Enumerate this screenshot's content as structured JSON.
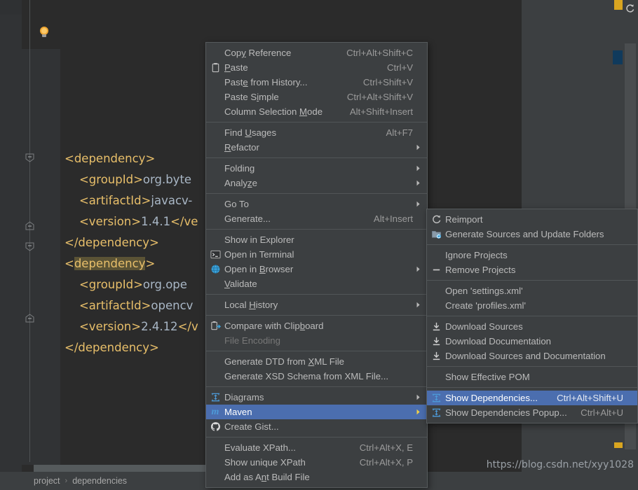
{
  "editor": {
    "breadcrumb": {
      "items": [
        "project",
        "dependencies"
      ],
      "separator": "›"
    },
    "watermark": "https://blog.csdn.net/xyy1028",
    "code_lines": [
      {
        "indent": 0,
        "segments": [
          {
            "t": "<dependency>",
            "c": "tag"
          }
        ]
      },
      {
        "indent": 1,
        "segments": [
          {
            "t": "<groupId>",
            "c": "tag"
          },
          {
            "t": "org.byte",
            "c": "txt"
          }
        ]
      },
      {
        "indent": 1,
        "segments": [
          {
            "t": "<artifactId>",
            "c": "tag"
          },
          {
            "t": "javacv-",
            "c": "txt"
          }
        ]
      },
      {
        "indent": 1,
        "segments": [
          {
            "t": "<version>",
            "c": "tag"
          },
          {
            "t": "1.4.1",
            "c": "txt"
          },
          {
            "t": "</ve",
            "c": "tag"
          }
        ]
      },
      {
        "indent": 0,
        "segments": [
          {
            "t": "</dependency>",
            "c": "tag"
          }
        ]
      },
      {
        "indent": 0,
        "segments": [
          {
            "t": "<",
            "c": "tag"
          },
          {
            "t": "dependency",
            "c": "tag sel"
          },
          {
            "t": ">",
            "c": "tag"
          }
        ]
      },
      {
        "indent": 1,
        "segments": [
          {
            "t": "<groupId>",
            "c": "tag"
          },
          {
            "t": "org.ope",
            "c": "txt"
          }
        ]
      },
      {
        "indent": 1,
        "segments": [
          {
            "t": "<artifactId>",
            "c": "tag"
          },
          {
            "t": "opencv",
            "c": "txt"
          }
        ]
      },
      {
        "indent": 1,
        "segments": [
          {
            "t": "<version>",
            "c": "tag"
          },
          {
            "t": "2.4.12",
            "c": "txt"
          },
          {
            "t": "</v",
            "c": "tag"
          }
        ]
      },
      {
        "indent": 0,
        "segments": [
          {
            "t": "</dependency>",
            "c": "tag"
          }
        ]
      }
    ]
  },
  "context_menu": {
    "items": [
      {
        "type": "item",
        "label": "Copy Reference",
        "mnemonic": "y",
        "accel": "Ctrl+Alt+Shift+C",
        "icon": "",
        "arrow": false
      },
      {
        "type": "item",
        "label": "Paste",
        "mnemonic": "P",
        "accel": "Ctrl+V",
        "icon": "clipboard-icon",
        "arrow": false
      },
      {
        "type": "item",
        "label": "Paste from History...",
        "mnemonic": "e",
        "accel": "Ctrl+Shift+V",
        "icon": "",
        "arrow": false
      },
      {
        "type": "item",
        "label": "Paste Simple",
        "mnemonic": "i",
        "accel": "Ctrl+Alt+Shift+V",
        "icon": "",
        "arrow": false
      },
      {
        "type": "item",
        "label": "Column Selection Mode",
        "mnemonic": "M",
        "accel": "Alt+Shift+Insert",
        "icon": "",
        "arrow": false
      },
      {
        "type": "sep"
      },
      {
        "type": "item",
        "label": "Find Usages",
        "mnemonic": "U",
        "accel": "Alt+F7",
        "icon": "",
        "arrow": false
      },
      {
        "type": "item",
        "label": "Refactor",
        "mnemonic": "R",
        "accel": "",
        "icon": "",
        "arrow": true
      },
      {
        "type": "sep"
      },
      {
        "type": "item",
        "label": "Folding",
        "mnemonic": "",
        "accel": "",
        "icon": "",
        "arrow": true
      },
      {
        "type": "item",
        "label": "Analyze",
        "mnemonic": "z",
        "accel": "",
        "icon": "",
        "arrow": true
      },
      {
        "type": "sep"
      },
      {
        "type": "item",
        "label": "Go To",
        "mnemonic": "",
        "accel": "",
        "icon": "",
        "arrow": true
      },
      {
        "type": "item",
        "label": "Generate...",
        "mnemonic": "",
        "accel": "Alt+Insert",
        "icon": "",
        "arrow": false
      },
      {
        "type": "sep"
      },
      {
        "type": "item",
        "label": "Show in Explorer",
        "mnemonic": "",
        "accel": "",
        "icon": "",
        "arrow": false
      },
      {
        "type": "item",
        "label": "Open in Terminal",
        "mnemonic": "",
        "accel": "",
        "icon": "terminal-icon",
        "arrow": false
      },
      {
        "type": "item",
        "label": "Open in Browser",
        "mnemonic": "B",
        "accel": "",
        "icon": "globe-icon",
        "arrow": true
      },
      {
        "type": "item",
        "label": "Validate",
        "mnemonic": "V",
        "accel": "",
        "icon": "",
        "arrow": false
      },
      {
        "type": "sep"
      },
      {
        "type": "item",
        "label": "Local History",
        "mnemonic": "H",
        "accel": "",
        "icon": "",
        "arrow": true
      },
      {
        "type": "sep"
      },
      {
        "type": "item",
        "label": "Compare with Clipboard",
        "mnemonic": "b",
        "accel": "",
        "icon": "compare-clipboard-icon",
        "arrow": false
      },
      {
        "type": "item",
        "label": "File Encoding",
        "mnemonic": "",
        "accel": "",
        "icon": "",
        "arrow": false,
        "disabled": true
      },
      {
        "type": "sep"
      },
      {
        "type": "item",
        "label": "Generate DTD from XML File",
        "mnemonic": "X",
        "accel": "",
        "icon": "",
        "arrow": false
      },
      {
        "type": "item",
        "label": "Generate XSD Schema from XML File...",
        "mnemonic": "",
        "accel": "",
        "icon": "",
        "arrow": false
      },
      {
        "type": "sep"
      },
      {
        "type": "item",
        "label": "Diagrams",
        "mnemonic": "",
        "accel": "",
        "icon": "diagram-icon",
        "arrow": true
      },
      {
        "type": "item",
        "label": "Maven",
        "mnemonic": "",
        "accel": "",
        "icon": "maven-icon",
        "arrow": true,
        "selected": true
      },
      {
        "type": "item",
        "label": "Create Gist...",
        "mnemonic": "",
        "accel": "",
        "icon": "github-icon",
        "arrow": false
      },
      {
        "type": "sep"
      },
      {
        "type": "item",
        "label": "Evaluate XPath...",
        "mnemonic": "",
        "accel": "Ctrl+Alt+X, E",
        "icon": "",
        "arrow": false
      },
      {
        "type": "item",
        "label": "Show unique XPath",
        "mnemonic": "",
        "accel": "Ctrl+Alt+X, P",
        "icon": "",
        "arrow": false
      },
      {
        "type": "item",
        "label": "Add as Ant Build File",
        "mnemonic": "n",
        "accel": "",
        "icon": "",
        "arrow": false
      }
    ]
  },
  "maven_menu": {
    "items": [
      {
        "type": "item",
        "label": "Reimport",
        "accel": "",
        "icon": "reimport-icon",
        "arrow": false
      },
      {
        "type": "item",
        "label": "Generate Sources and Update Folders",
        "accel": "",
        "icon": "generate-sources-icon",
        "arrow": false
      },
      {
        "type": "sep"
      },
      {
        "type": "item",
        "label": "Ignore Projects",
        "accel": "",
        "icon": "",
        "arrow": false
      },
      {
        "type": "item",
        "label": "Remove Projects",
        "accel": "",
        "icon": "minus-icon",
        "arrow": false
      },
      {
        "type": "sep"
      },
      {
        "type": "item",
        "label": "Open 'settings.xml'",
        "accel": "",
        "icon": "",
        "arrow": false
      },
      {
        "type": "item",
        "label": "Create 'profiles.xml'",
        "accel": "",
        "icon": "",
        "arrow": false
      },
      {
        "type": "sep"
      },
      {
        "type": "item",
        "label": "Download Sources",
        "accel": "",
        "icon": "download-icon",
        "arrow": false
      },
      {
        "type": "item",
        "label": "Download Documentation",
        "accel": "",
        "icon": "download-icon",
        "arrow": false
      },
      {
        "type": "item",
        "label": "Download Sources and Documentation",
        "accel": "",
        "icon": "download-icon",
        "arrow": false
      },
      {
        "type": "sep"
      },
      {
        "type": "item",
        "label": "Show Effective POM",
        "accel": "",
        "icon": "",
        "arrow": false
      },
      {
        "type": "sep"
      },
      {
        "type": "item",
        "label": "Show Dependencies...",
        "accel": "Ctrl+Alt+Shift+U",
        "icon": "diagram-icon",
        "arrow": false,
        "selected": true
      },
      {
        "type": "item",
        "label": "Show Dependencies Popup...",
        "accel": "Ctrl+Alt+U",
        "icon": "diagram-icon",
        "arrow": false
      }
    ]
  },
  "toolbar": {
    "refresh_icon": "refresh-icon",
    "lightbulb_icon": "lightbulb-icon"
  },
  "colors": {
    "selection_blue": "#4b6eaf",
    "menu_bg": "#3c3f41",
    "editor_bg": "#2b2b2b",
    "tag_color": "#e8bf6a",
    "text_color": "#a9b7c6",
    "marker_yellow": "#d9a520"
  }
}
